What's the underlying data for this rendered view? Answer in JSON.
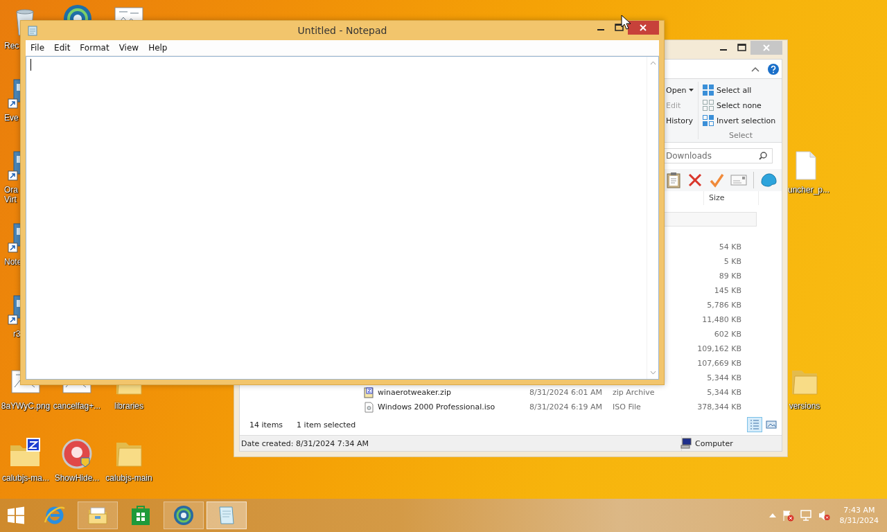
{
  "desktop_icons": [
    {
      "kind": "bin",
      "label": "Rec"
    },
    {
      "kind": "globe"
    },
    {
      "kind": "image"
    },
    {
      "kind": "shortcut",
      "label": "Eve"
    },
    {
      "kind": "shortcut",
      "label": "Ora Virt"
    },
    {
      "kind": "shortcut",
      "label": "Note"
    },
    {
      "kind": "shortcut",
      "label": "r3"
    },
    {
      "kind": "image",
      "label": "8aYWyC.png"
    },
    {
      "kind": "image",
      "label": "cancelfag+..."
    },
    {
      "kind": "folder",
      "label": "libraries"
    },
    {
      "kind": "zipfolder",
      "label": "calubjs-ma..."
    },
    {
      "kind": "app",
      "label": "ShowHide..."
    },
    {
      "kind": "folder",
      "label": "calubjs-main"
    },
    {
      "kind": "file",
      "label": "uncher_p..."
    },
    {
      "kind": "folder",
      "label": "versions"
    }
  ],
  "explorer": {
    "ribbon": {
      "open_group": [
        {
          "label": "Open",
          "dropdown": true,
          "disabled": false
        },
        {
          "label": "Edit",
          "dropdown": false,
          "disabled": true
        },
        {
          "label": "History",
          "dropdown": false,
          "disabled": false
        }
      ],
      "select_group": {
        "label": "Select",
        "items": [
          "Select all",
          "Select none",
          "Invert selection"
        ]
      }
    },
    "search": {
      "placeholder": "Downloads"
    },
    "columns": [
      "Size"
    ],
    "files": [
      {
        "size": "54 KB"
      },
      {
        "size": "5 KB"
      },
      {
        "size": "89 KB"
      },
      {
        "size": "145 KB"
      },
      {
        "size": "5,786 KB"
      },
      {
        "size": "11,480 KB"
      },
      {
        "size": "602 KB"
      },
      {
        "size": "109,162 KB"
      },
      {
        "size": "107,669 KB"
      },
      {
        "size": "5,344 KB"
      },
      {
        "kind": "zip",
        "name": "winaerotweaker.zip",
        "date": "8/31/2024 6:01 AM",
        "type": "zip Archive",
        "size": "5,344 KB"
      },
      {
        "kind": "disc",
        "name": "Windows 2000 Professional.iso",
        "date": "8/31/2024 6:19 AM",
        "type": "ISO File",
        "size": "378,344 KB"
      }
    ],
    "status": {
      "count": "14 items",
      "selection": "1 item selected"
    },
    "view_buttons": [
      {
        "kind": "details",
        "selected": true
      },
      {
        "kind": "thumbnails",
        "selected": false
      }
    ],
    "details_bar": {
      "text": "Date created: 8/31/2024 7:34 AM",
      "location": "Computer"
    }
  },
  "notepad": {
    "title": "Untitled - Notepad",
    "menu": [
      "File",
      "Edit",
      "Format",
      "View",
      "Help"
    ]
  },
  "taskbar": {
    "apps": [
      {
        "kind": "browser",
        "running": false,
        "active": false
      },
      {
        "kind": "files",
        "running": true,
        "active": false
      },
      {
        "kind": "store",
        "running": false,
        "active": false
      },
      {
        "kind": "globe",
        "running": true,
        "active": false
      },
      {
        "kind": "notepad",
        "running": true,
        "active": true
      }
    ],
    "clock": {
      "time": "7:43 AM",
      "date": "8/31/2024"
    }
  }
}
